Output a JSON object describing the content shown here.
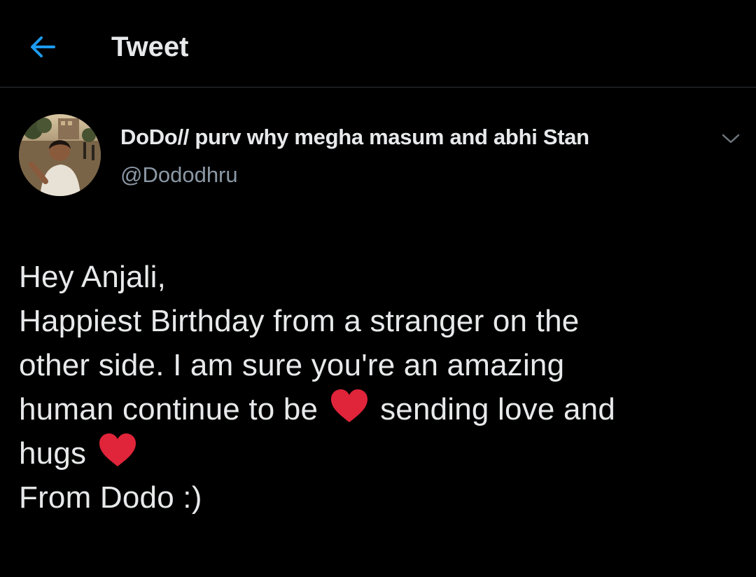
{
  "header": {
    "title": "Tweet",
    "back_icon": "arrow-left-icon",
    "accent_color": "#1d9bf0"
  },
  "tweet": {
    "author": {
      "display_name": "DoDo// purv why megha masum and abhi Stan",
      "handle": "@Dododhru",
      "avatar_icon": "profile-photo"
    },
    "more_icon": "chevron-down-icon",
    "body": {
      "line1": "Hey Anjali,",
      "line2": "Happiest Birthday from a stranger on the",
      "line3": "other side. I am sure you're an amazing",
      "line4a": "human continue to be",
      "line4b": "sending love and",
      "line5": "hugs",
      "line6": "From Dodo :)"
    },
    "emoji": "red-heart",
    "heart_color": "#e0243a"
  }
}
